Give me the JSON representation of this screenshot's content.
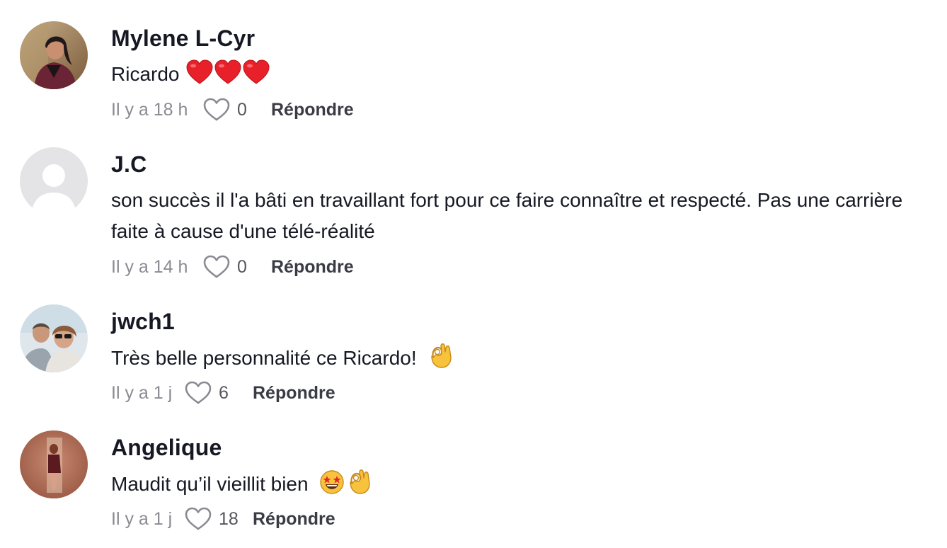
{
  "comments": [
    {
      "username": "Mylene L-Cyr",
      "text": "Ricardo",
      "emojis": [
        "heart",
        "heart",
        "heart"
      ],
      "time": "Il y a 18 h",
      "likes": "0",
      "reply_label": "Répondre"
    },
    {
      "username": "J.C",
      "text": "son succès il l'a bâti en travaillant fort pour ce faire connaître et respecté. Pas une carrière faite à cause d'une télé-réalité",
      "emojis": [],
      "time": "Il y a 14 h",
      "likes": "0",
      "reply_label": "Répondre"
    },
    {
      "username": "jwch1",
      "text": "Très belle personnalité ce Ricardo!",
      "emojis": [
        "ok-hand"
      ],
      "time": "Il y a 1 j",
      "likes": "6",
      "reply_label": "Répondre"
    },
    {
      "username": "Angelique",
      "text": "Maudit qu’il vieillit bien",
      "emojis": [
        "star-struck",
        "ok-hand"
      ],
      "time": "Il y a 1 j",
      "likes": "18",
      "reply_label": "Répondre"
    }
  ],
  "icons": {
    "like": "heart-outline-icon"
  },
  "colors": {
    "username": "#161823",
    "meta": "#8a8b91",
    "emoji_heart": "#e8202a",
    "emoji_yellow": "#f7c23c"
  }
}
